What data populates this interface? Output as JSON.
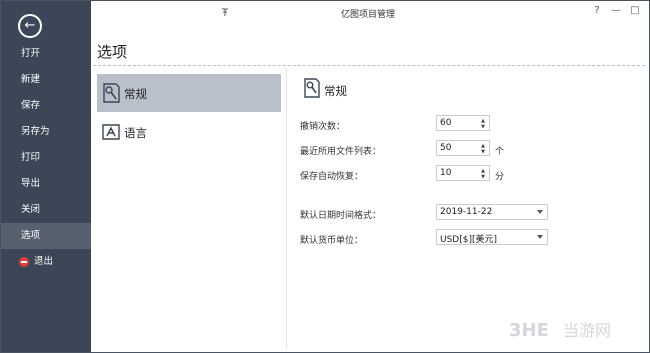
{
  "window": {
    "title": "亿图项目管理"
  },
  "sidebar": {
    "items": [
      {
        "label": "打开"
      },
      {
        "label": "新建"
      },
      {
        "label": "保存"
      },
      {
        "label": "另存为"
      },
      {
        "label": "打印"
      },
      {
        "label": "导出"
      },
      {
        "label": "关闭"
      },
      {
        "label": "选项"
      },
      {
        "label": "退出"
      }
    ]
  },
  "page": {
    "title": "选项"
  },
  "categories": [
    {
      "label": "常规"
    },
    {
      "label": "语言"
    }
  ],
  "general": {
    "title": "常规",
    "undo": {
      "label": "撤销次数：",
      "value": "60"
    },
    "recent": {
      "label": "最近所用文件列表：",
      "value": "50",
      "unit": "个"
    },
    "autosave": {
      "label": "保存自动恢复：",
      "value": "10",
      "unit": "分"
    },
    "date_format": {
      "label": "默认日期时间格式：",
      "value": "2019-11-22"
    },
    "currency": {
      "label": "默认货币单位：",
      "value": "USD[$][美元]"
    }
  },
  "watermark": {
    "text": "当游网",
    "brand": "3HE"
  }
}
